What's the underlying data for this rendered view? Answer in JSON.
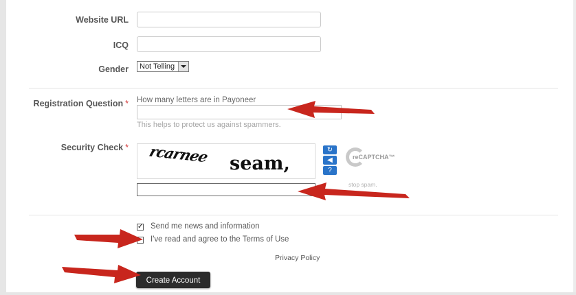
{
  "fields": {
    "website_url": {
      "label": "Website URL",
      "value": ""
    },
    "icq": {
      "label": "ICQ",
      "value": ""
    },
    "gender": {
      "label": "Gender",
      "selected": "Not Telling"
    }
  },
  "registration_question": {
    "label": "Registration Question",
    "required_mark": "*",
    "question": "How many letters are in Payoneer",
    "value": "",
    "hint": "This helps to protect us against spammers."
  },
  "security_check": {
    "label": "Security Check",
    "required_mark": "*",
    "captcha_words": [
      "rcarnee",
      "seam,"
    ],
    "value": "",
    "logo_text": "reCAPTCHA™",
    "stop_text": "stop spam.",
    "icons": [
      "refresh-icon",
      "audio-icon",
      "help-icon"
    ]
  },
  "options": {
    "news": {
      "label": "Send me news and information",
      "checked": true
    },
    "terms": {
      "label": "I've read and agree to the Terms of Use",
      "checked": false
    }
  },
  "privacy_link": "Privacy Policy",
  "submit_label": "Create Account",
  "colors": {
    "arrow": "#c8261d",
    "button": "#2c2c2c",
    "recaptcha_blue": "#2a74c9",
    "required": "#d43b3b"
  }
}
